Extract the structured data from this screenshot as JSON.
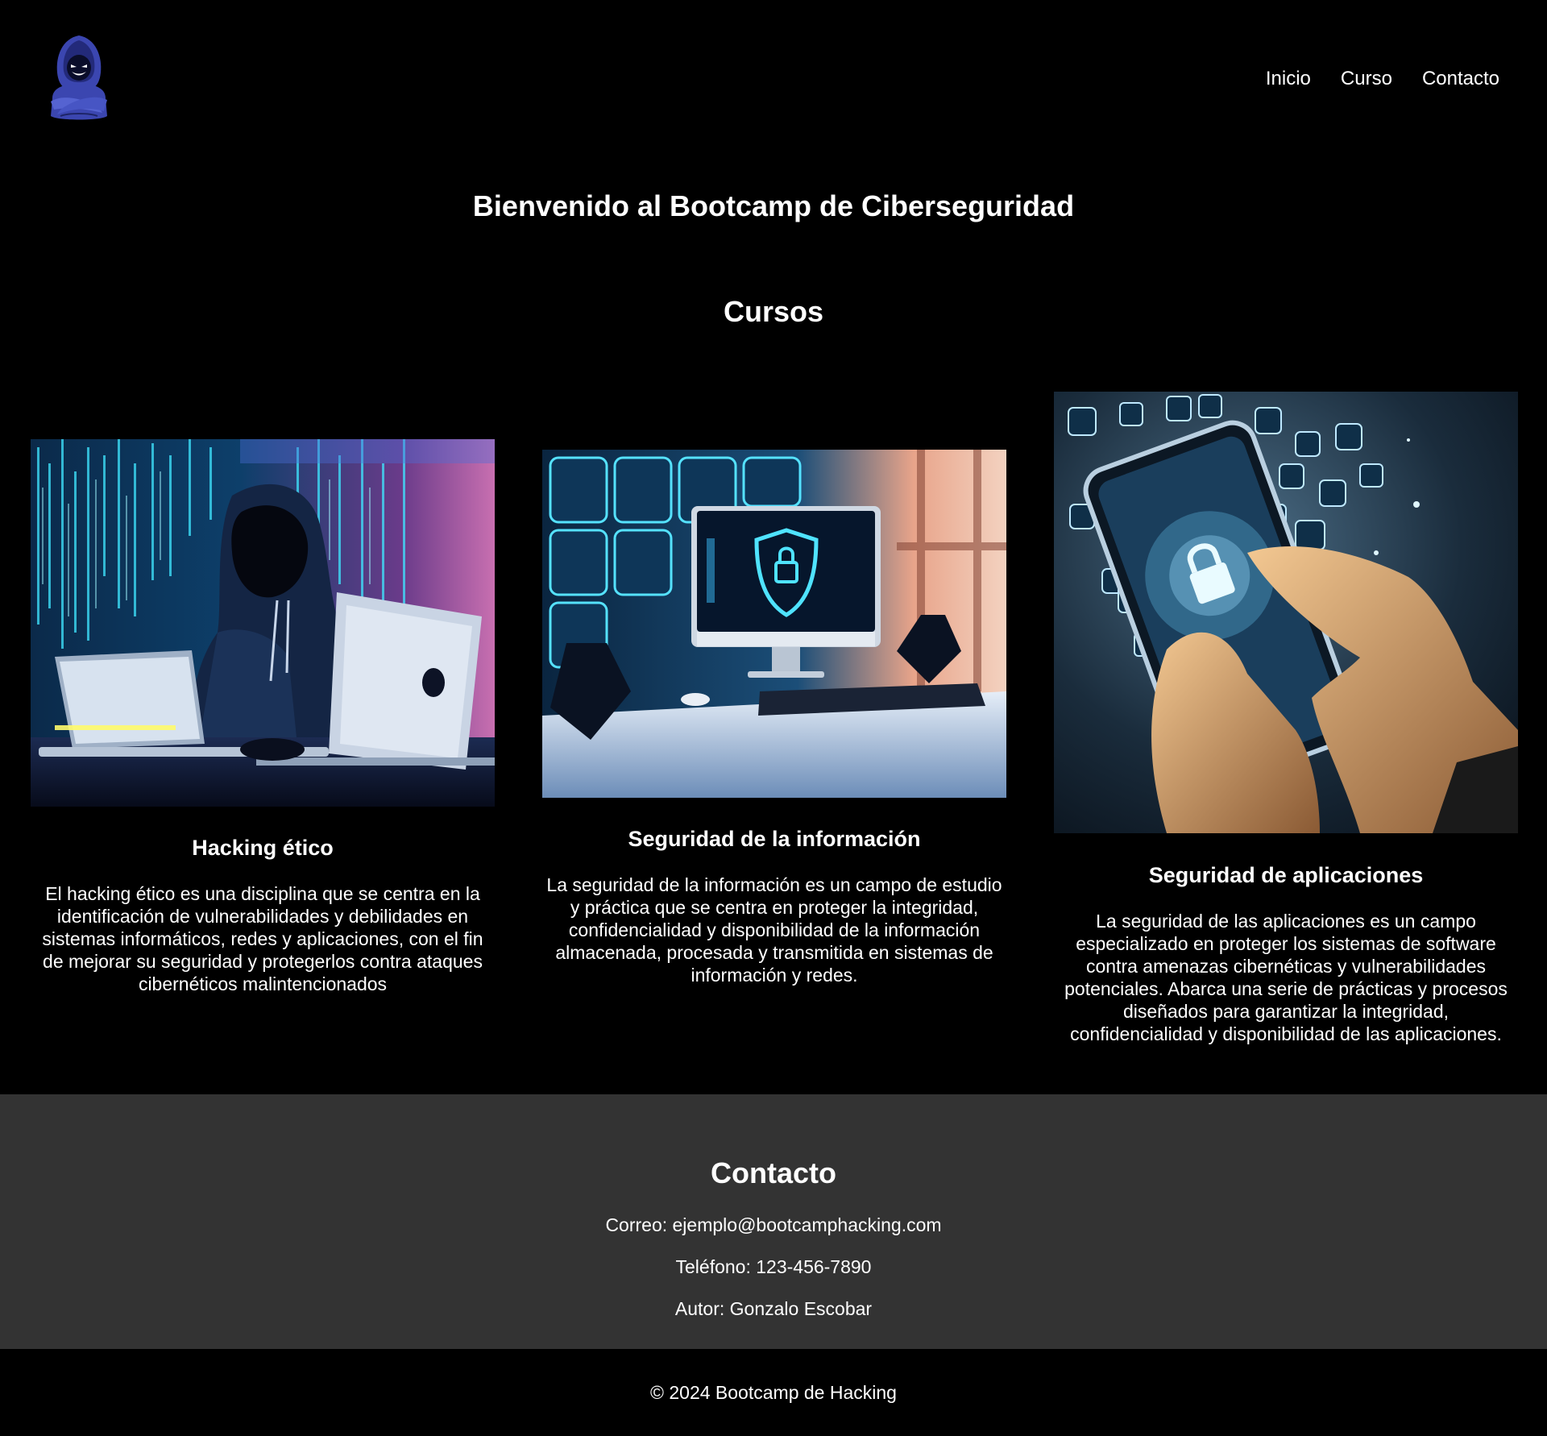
{
  "nav": {
    "items": [
      {
        "label": "Inicio"
      },
      {
        "label": "Curso"
      },
      {
        "label": "Contacto"
      }
    ]
  },
  "hero": {
    "title": "Bienvenido al Bootcamp de Ciberseguridad"
  },
  "courses": {
    "title": "Cursos",
    "items": [
      {
        "title": "Hacking ético",
        "description": "El hacking ético es una disciplina que se centra en la identificación de vulnerabilidades y debilidades en sistemas informáticos, redes y aplicaciones, con el fin de mejorar su seguridad y protegerlos contra ataques cibernéticos malintencionados",
        "image_icon": "hooded-hacker-laptop-image"
      },
      {
        "title": "Seguridad de la información",
        "description": "La seguridad de la información es un campo de estudio y práctica que se centra en proteger la integridad, confidencialidad y disponibilidad de la información almacenada, procesada y transmitida en sistemas de información y redes.",
        "image_icon": "monitor-padlock-shield-image"
      },
      {
        "title": "Seguridad de aplicaciones",
        "description": "La seguridad de las aplicaciones es un campo especializado en proteger los sistemas de software contra amenazas cibernéticas y vulnerabilidades potenciales. Abarca una serie de prácticas y procesos diseñados para garantizar la integridad, confidencialidad y disponibilidad de las aplicaciones.",
        "image_icon": "smartphone-padlock-hand-image"
      }
    ]
  },
  "contact": {
    "title": "Contacto",
    "email": "Correo: ejemplo@bootcamphacking.com",
    "phone": "Teléfono: 123-456-7890",
    "author": "Autor: Gonzalo Escobar"
  },
  "footer": {
    "copyright": "© 2024 Bootcamp de Hacking"
  },
  "colors": {
    "background": "#000000",
    "contact_background": "#333333",
    "text": "#ffffff",
    "accent_cyan": "#4fe3ff",
    "logo_blue": "#3d4fb8"
  }
}
